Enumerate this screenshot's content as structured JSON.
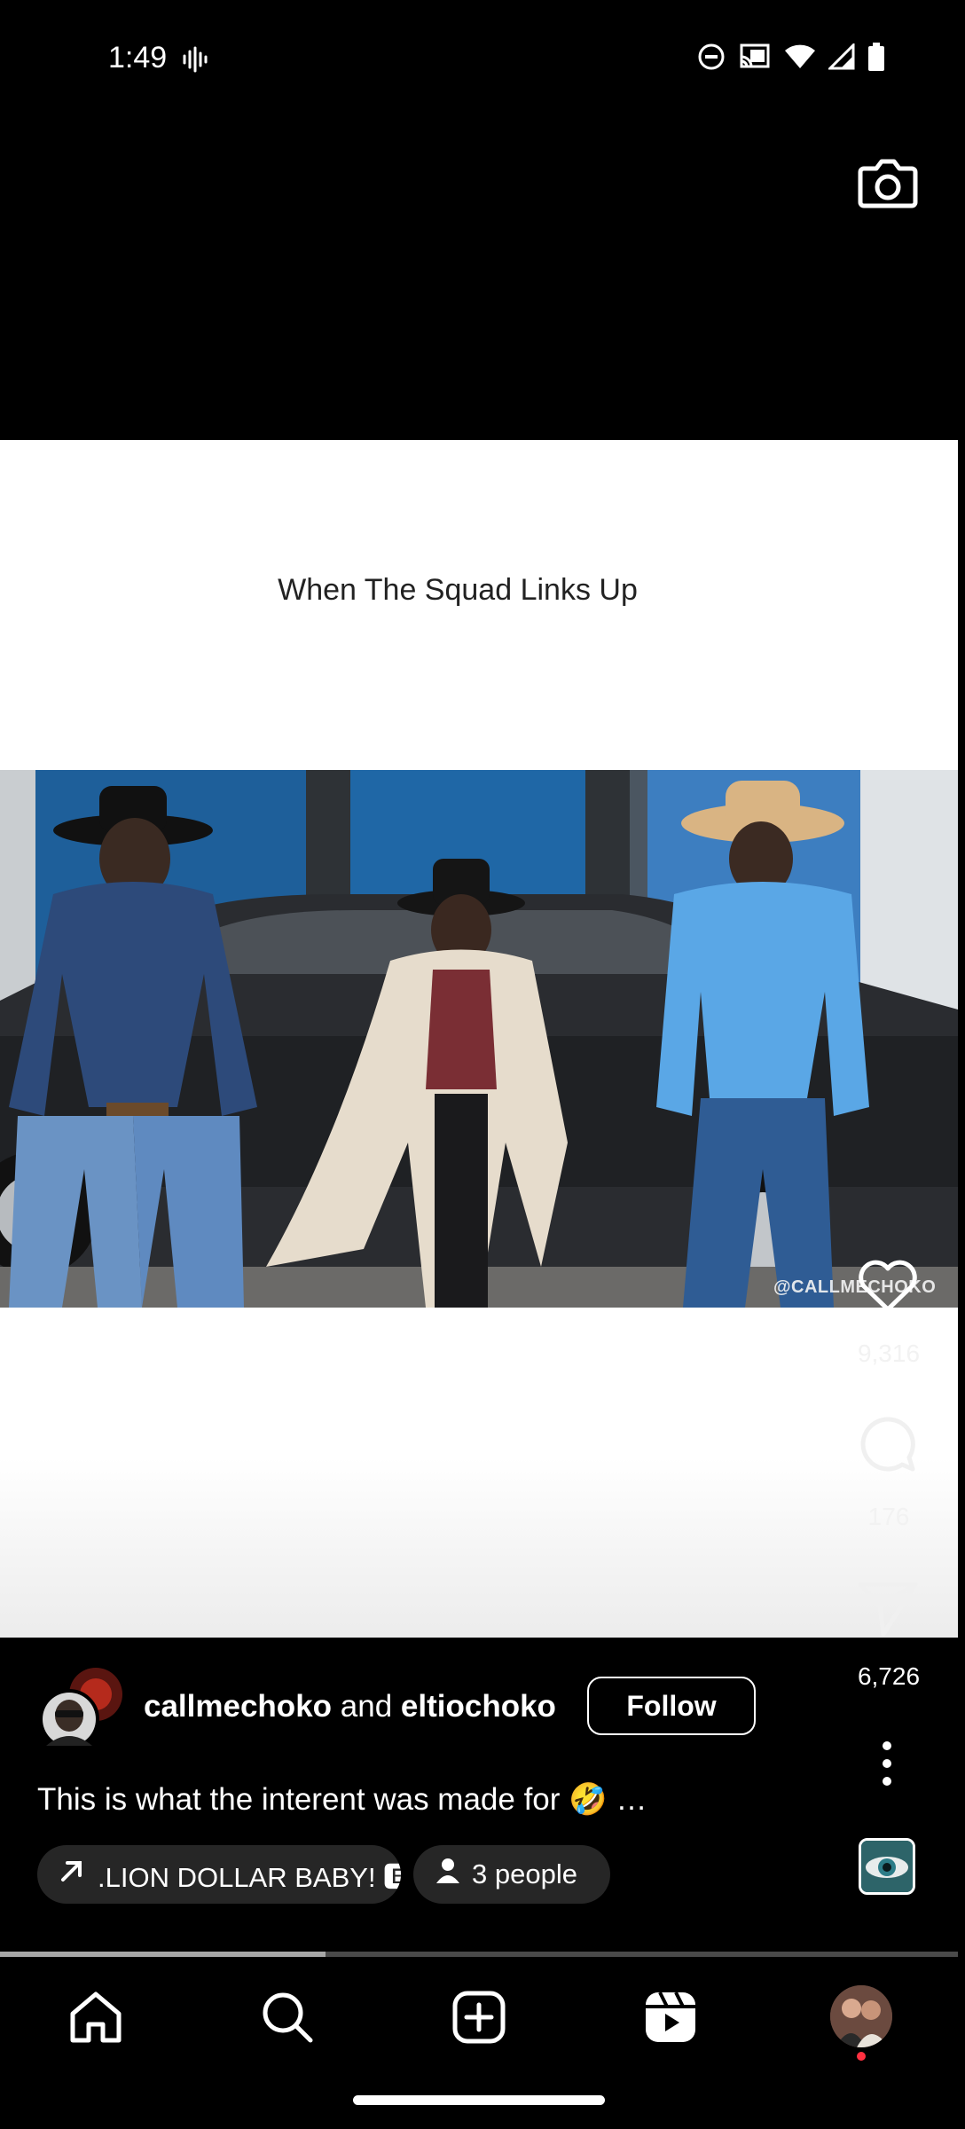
{
  "status_bar": {
    "time": "1:49"
  },
  "video": {
    "caption": "When The Squad Links Up",
    "watermark": "@CALLMECHOKO"
  },
  "actions": {
    "likes": "9,316",
    "comments": "176",
    "shares": "6,726"
  },
  "post": {
    "author_1": "callmechoko",
    "joiner": "and",
    "author_2": "eltiochoko",
    "follow_label": "Follow",
    "caption": "This is what the interent was made for 🤣 …",
    "audio_chip": ".LION DOLLAR BABY! 🅴",
    "people_chip": "3 people"
  },
  "playback": {
    "progress_fraction": 0.34
  },
  "nav": {
    "items": [
      "home-icon",
      "search-icon",
      "create-icon",
      "reels-icon",
      "profile-avatar"
    ]
  },
  "colors": {
    "background": "#000000",
    "chip": "#262626",
    "notification_dot": "#ff3040"
  }
}
